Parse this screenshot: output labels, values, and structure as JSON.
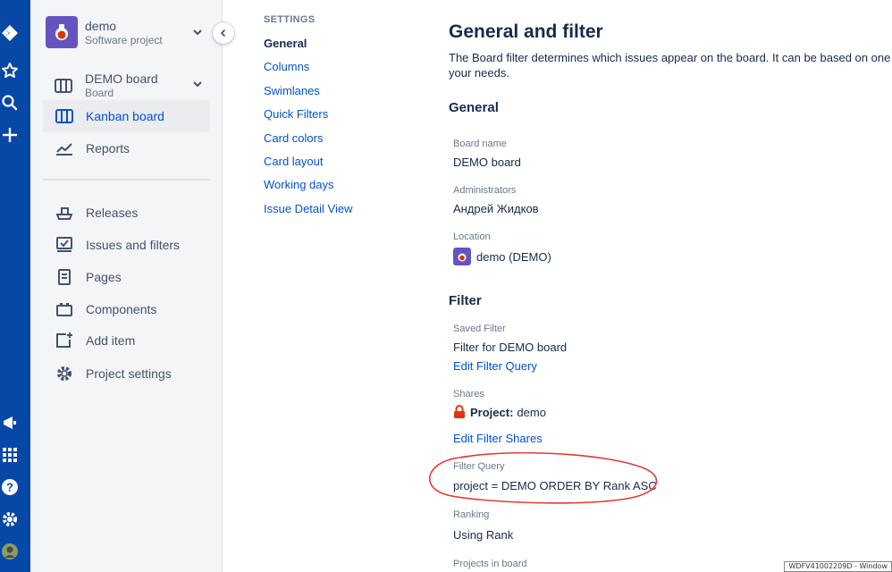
{
  "sidebar": {
    "project": {
      "name": "demo",
      "type": "Software project"
    },
    "board": {
      "name": "DEMO board",
      "type": "Board"
    },
    "items": [
      {
        "label": "Kanban board",
        "icon": "kanban-board-icon"
      },
      {
        "label": "Reports",
        "icon": "reports-icon"
      },
      {
        "label": "Releases",
        "icon": "releases-icon"
      },
      {
        "label": "Issues and filters",
        "icon": "issues-filters-icon"
      },
      {
        "label": "Pages",
        "icon": "pages-icon"
      },
      {
        "label": "Components",
        "icon": "components-icon"
      },
      {
        "label": "Add item",
        "icon": "add-item-icon"
      },
      {
        "label": "Project settings",
        "icon": "gear-icon"
      }
    ]
  },
  "settings_nav": {
    "heading": "SETTINGS",
    "items": [
      "General",
      "Columns",
      "Swimlanes",
      "Quick Filters",
      "Card colors",
      "Card layout",
      "Working days",
      "Issue Detail View"
    ]
  },
  "main": {
    "title": "General and filter",
    "description": "The Board filter determines which issues appear on the board. It can be based on one or r your needs.",
    "general_section": "General",
    "board_name_label": "Board name",
    "board_name_value": "DEMO board",
    "administrators_label": "Administrators",
    "administrators_value": "Андрей Жидков",
    "location_label": "Location",
    "location_value": "demo (DEMO)",
    "filter_section": "Filter",
    "saved_filter_label": "Saved Filter",
    "saved_filter_value": "Filter for DEMO board",
    "edit_filter_query": "Edit Filter Query",
    "shares_label": "Shares",
    "shares_prefix": "Project:",
    "shares_value": "demo",
    "edit_filter_shares": "Edit Filter Shares",
    "filter_query_label": "Filter Query",
    "filter_query_value": "project = DEMO ORDER BY Rank ASC",
    "ranking_label": "Ranking",
    "ranking_value": "Using Rank",
    "projects_in_board_label": "Projects in board"
  },
  "status_bar": {
    "text": "WDFV41002209D - Window"
  },
  "colors": {
    "rail": "#0747a6",
    "link": "#0052cc",
    "text": "#172b4d",
    "annotation": "#e53935",
    "project_avatar": "#6554c0"
  }
}
